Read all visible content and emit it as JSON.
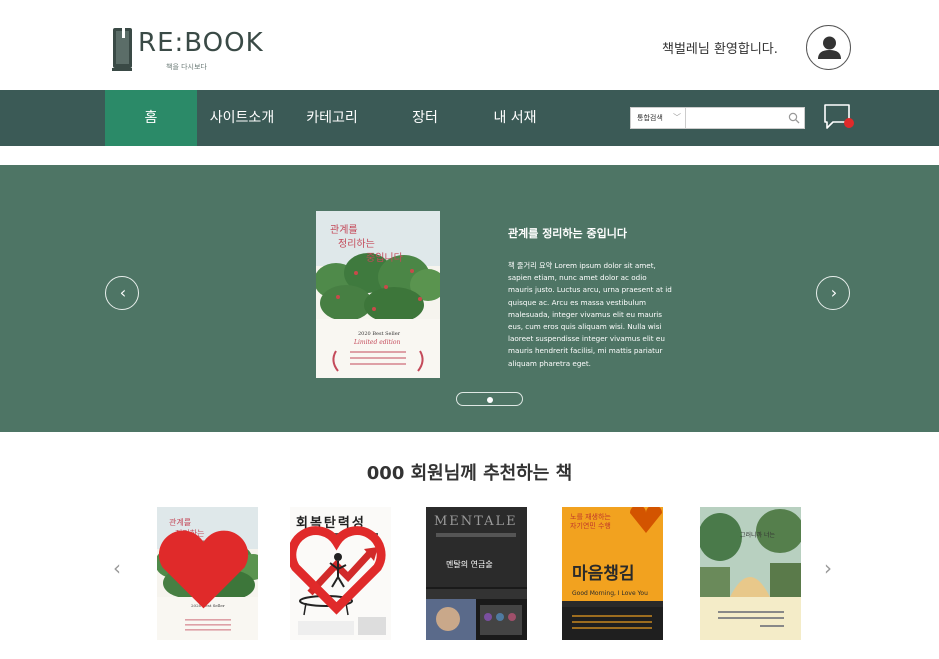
{
  "header": {
    "logo_text": "RE:BOOK",
    "logo_sub": "책을 다시보다",
    "welcome": "책벌레님 환영합니다."
  },
  "nav": {
    "items": [
      "홈",
      "사이트소개",
      "카테고리",
      "장터",
      "내 서재"
    ],
    "active_index": 0,
    "search_select": "통합검색",
    "search_placeholder": ""
  },
  "hero": {
    "cover_title": "관계를 정리하는 중입니다",
    "cover_badge": "2020 Best Seller",
    "cover_edition": "Limited edition",
    "title": "관계를 정리하는 중입니다",
    "description": "책 줄거리 요약 Lorem ipsum dolor sit amet, sapien etiam, nunc amet dolor ac odio mauris justo. Luctus arcu, urna praesent at id quisque ac. Arcu es massa vestibulum malesuada, integer vivamus elit eu mauris eus, cum eros quis aliquam wisi. Nulla wisi laoreet suspendisse integer vivamus elit eu mauris hendrerit facilisi, mi mattis pariatur aliquam pharetra eget.",
    "slide_count": 3,
    "active_slide": 1
  },
  "recommend": {
    "title": "000 회원님께 추천하는 책",
    "books": [
      {
        "title": "관계를 정리하는 중입니다",
        "liked": true
      },
      {
        "title": "회복탄력성",
        "liked": false
      },
      {
        "title": "멘탈의 연금술",
        "liked": false
      },
      {
        "title": "마음챙김",
        "liked": false
      },
      {
        "title": "",
        "liked": false
      }
    ]
  },
  "colors": {
    "nav_bg": "#3b5a56",
    "nav_active": "#2b8a68",
    "hero_bg": "#4e7565",
    "notify": "#e02a2a"
  }
}
